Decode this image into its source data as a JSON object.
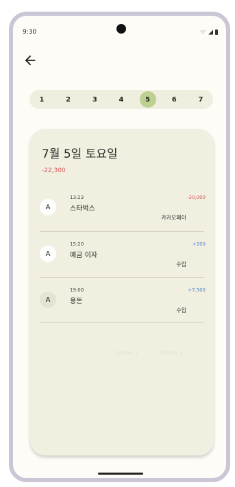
{
  "top_caption": "",
  "status_bar": {
    "time": "9:30"
  },
  "icons": {
    "back": "arrow-left-icon"
  },
  "days": [
    "1",
    "2",
    "3",
    "4",
    "5",
    "6",
    "7"
  ],
  "selected_day_index": 4,
  "card": {
    "title": "7월 5일 토요일",
    "total": "-22,300",
    "transactions": [
      {
        "avatar": "A",
        "time": "13:23",
        "name": "스타벅스",
        "method": "카카오페이",
        "amount": "-30,000",
        "sign": "negative"
      },
      {
        "avatar": "A",
        "time": "15:20",
        "name": "예금 이자",
        "method": "수입",
        "amount": "+200",
        "sign": "positive"
      },
      {
        "avatar": "A",
        "time": "19:00",
        "name": "용돈",
        "method": "수입",
        "amount": "+7,500",
        "sign": "positive"
      }
    ],
    "actions": [
      "Action 2",
      "Action 1"
    ]
  },
  "colors": {
    "accent_selected_day": "#bdd08f",
    "negative": "#d05555",
    "positive": "#4a86d8"
  }
}
